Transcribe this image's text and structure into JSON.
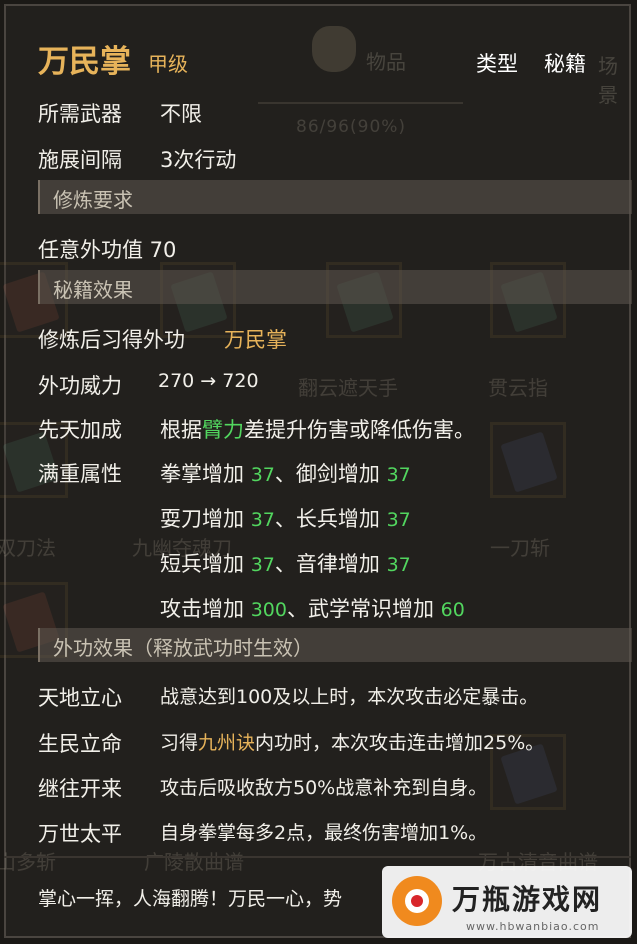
{
  "background": {
    "tab_label": "物品",
    "tab2_label": "场景",
    "progress": "86/96(90%)",
    "item_names": [
      "翻云遮天手",
      "贯云指",
      "双刀法",
      "九幽夺魂刀",
      "一刀斩",
      "广陵散曲谱",
      "山多斩",
      "万古清音曲谱"
    ]
  },
  "header": {
    "title": "万民掌",
    "grade": "甲级",
    "type_label": "类型",
    "type_value": "秘籍"
  },
  "basic": [
    {
      "label": "所需武器",
      "value": "不限"
    },
    {
      "label": "施展间隔",
      "value": "3次行动"
    }
  ],
  "sections": {
    "requirement": "修炼要求",
    "effect": "秘籍效果",
    "external": "外功效果（释放武功时生效）"
  },
  "requirement_text": "任意外功值 70",
  "learn": {
    "label": "修炼后习得外功",
    "value": "万民掌"
  },
  "power": {
    "label": "外功威力",
    "value": "270 → 720"
  },
  "innate": {
    "label": "先天加成",
    "pre": "根据",
    "highlight": "臂力",
    "post": "差提升伤害或降低伤害。"
  },
  "full_attr": {
    "label": "满重属性",
    "lines": [
      {
        "a": "拳掌增加 ",
        "a_val": "37",
        "b": "、御剑增加 ",
        "b_val": "37"
      },
      {
        "a": "耍刀增加 ",
        "a_val": "37",
        "b": "、长兵增加 ",
        "b_val": "37"
      },
      {
        "a": "短兵增加 ",
        "a_val": "37",
        "b": "、音律增加 ",
        "b_val": "37"
      },
      {
        "a": "攻击增加 ",
        "a_val": "300",
        "b": "、武学常识增加 ",
        "b_val": "60"
      }
    ]
  },
  "external_effects": [
    {
      "label": "天地立心",
      "pre": "战意达到100及以上时，本次攻击必定暴击。",
      "highlight": "",
      "post": ""
    },
    {
      "label": "生民立命",
      "pre": "习得",
      "highlight": "九州诀",
      "post": "内功时，本次攻击连击增加25%。"
    },
    {
      "label": "继往开来",
      "pre": "攻击后吸收敌方50%战意补充到自身。",
      "highlight": "",
      "post": ""
    },
    {
      "label": "万世太平",
      "pre": "自身拳掌每多2点，最终伤害增加1%。",
      "highlight": "",
      "post": ""
    }
  ],
  "footer": "掌心一挥，人海翻腾！万民一心，势",
  "watermark": {
    "title": "万瓶游戏网",
    "url": "www.hbwanbiao.com"
  },
  "colors": {
    "gold": "#e7b35a",
    "green": "#52d65f",
    "text": "#f1efe9"
  }
}
